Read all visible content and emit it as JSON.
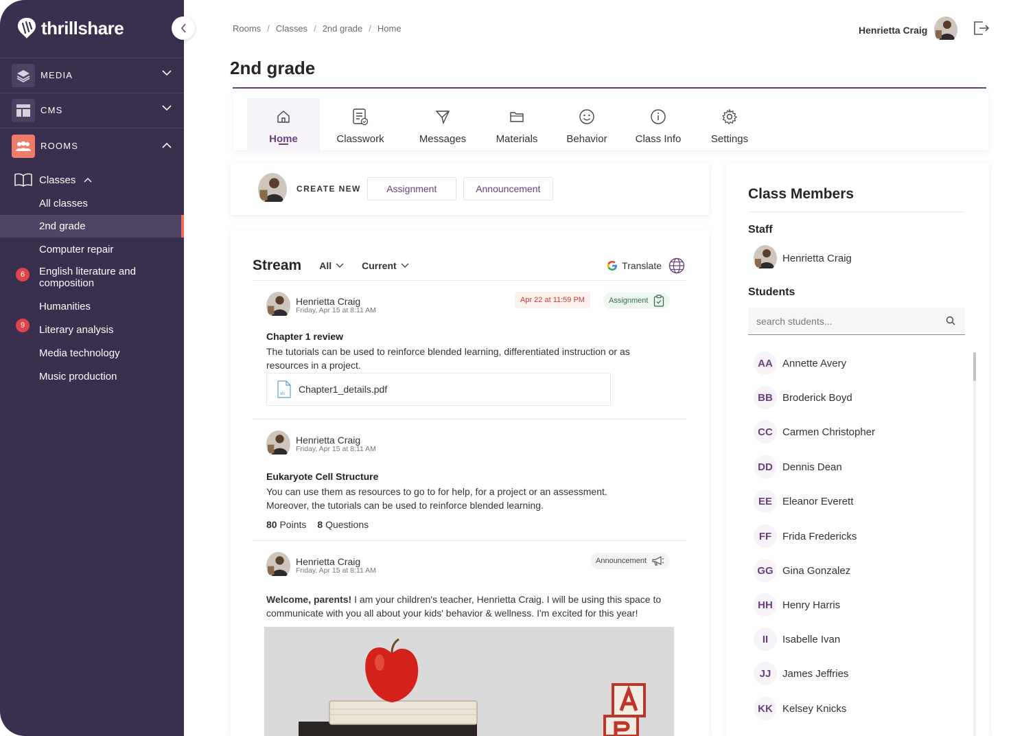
{
  "brand": {
    "name": "thrillshare"
  },
  "sidebar": {
    "sections": [
      {
        "label": "MEDIA",
        "icon": "layers-icon"
      },
      {
        "label": "CMS",
        "icon": "layout-icon"
      },
      {
        "label": "ROOMS",
        "icon": "people-icon"
      }
    ],
    "classes_label": "Classes",
    "items": [
      {
        "label": "All classes"
      },
      {
        "label": "2nd grade",
        "active": true
      },
      {
        "label": "Computer repair"
      },
      {
        "label": "English literature and composition",
        "badge": "6"
      },
      {
        "label": "Humanities"
      },
      {
        "label": "Literary analysis",
        "badge": "9"
      },
      {
        "label": "Media technology"
      },
      {
        "label": "Music production"
      }
    ]
  },
  "breadcrumb": [
    "Rooms",
    "Classes",
    "2nd grade",
    "Home"
  ],
  "user": {
    "name": "Henrietta Craig"
  },
  "page": {
    "title": "2nd grade"
  },
  "tabs": [
    {
      "label": "Home",
      "icon": "home-icon",
      "active": true
    },
    {
      "label": "Classwork",
      "icon": "classwork-icon"
    },
    {
      "label": "Messages",
      "icon": "send-icon"
    },
    {
      "label": "Materials",
      "icon": "folder-icon"
    },
    {
      "label": "Behavior",
      "icon": "smiley-icon"
    },
    {
      "label": "Class Info",
      "icon": "info-icon"
    },
    {
      "label": "Settings",
      "icon": "gear-icon"
    }
  ],
  "create_new": {
    "label": "CREATE NEW",
    "assignment": "Assignment",
    "announcement": "Announcement"
  },
  "stream": {
    "title": "Stream",
    "filter_all": "All",
    "filter_current": "Current",
    "translate": "Translate",
    "posts": [
      {
        "author": "Henrietta Craig",
        "date": "Friday, Apr 15 at 8:11 AM",
        "due": "Apr 22 at 11:59 PM",
        "tag": "Assignment",
        "title": "Chapter 1 review",
        "body": "The tutorials can be used to reinforce blended learning, differentiated instruction or as resources in a project.",
        "file": "Chapter1_details.pdf",
        "file_ext": "xls"
      },
      {
        "author": "Henrietta Craig",
        "date": "Friday, Apr 15 at 8:11 AM",
        "title": "Eukaryote Cell Structure",
        "body": "You can use them as resources to go to for help, for a project or an assessment. Moreover, the tutorials can be used to reinforce blended learning.",
        "points_num": "80",
        "points_label": "Points",
        "questions_num": "8",
        "questions_label": "Questions"
      },
      {
        "author": "Henrietta Craig",
        "date": "Friday, Apr 15 at 8:11 AM",
        "tag": "Announcement",
        "lead": "Welcome, parents!",
        "body": " I am your children's teacher, Henrietta Craig. I will be using this space to communicate with you all about your kids' behavior & wellness. I'm excited for this year!"
      }
    ]
  },
  "members": {
    "title": "Class Members",
    "staff_label": "Staff",
    "staff": [
      {
        "name": "Henrietta Craig"
      }
    ],
    "students_label": "Students",
    "search_placeholder": "search students...",
    "students": [
      {
        "initials": "AA",
        "name": "Annette Avery"
      },
      {
        "initials": "BB",
        "name": "Broderick Boyd"
      },
      {
        "initials": "CC",
        "name": "Carmen Christopher"
      },
      {
        "initials": "DD",
        "name": "Dennis Dean"
      },
      {
        "initials": "EE",
        "name": "Eleanor Everett"
      },
      {
        "initials": "FF",
        "name": "Frida Fredericks"
      },
      {
        "initials": "GG",
        "name": "Gina Gonzalez"
      },
      {
        "initials": "HH",
        "name": "Henry Harris"
      },
      {
        "initials": "II",
        "name": "Isabelle Ivan"
      },
      {
        "initials": "JJ",
        "name": "James Jeffries"
      },
      {
        "initials": "KK",
        "name": "Kelsey Knicks"
      }
    ]
  },
  "colors": {
    "sidebar": "#3a2f4f",
    "accent": "#6a3f7e",
    "badge": "#e0434a",
    "active_marker": "#ef6d5d"
  }
}
